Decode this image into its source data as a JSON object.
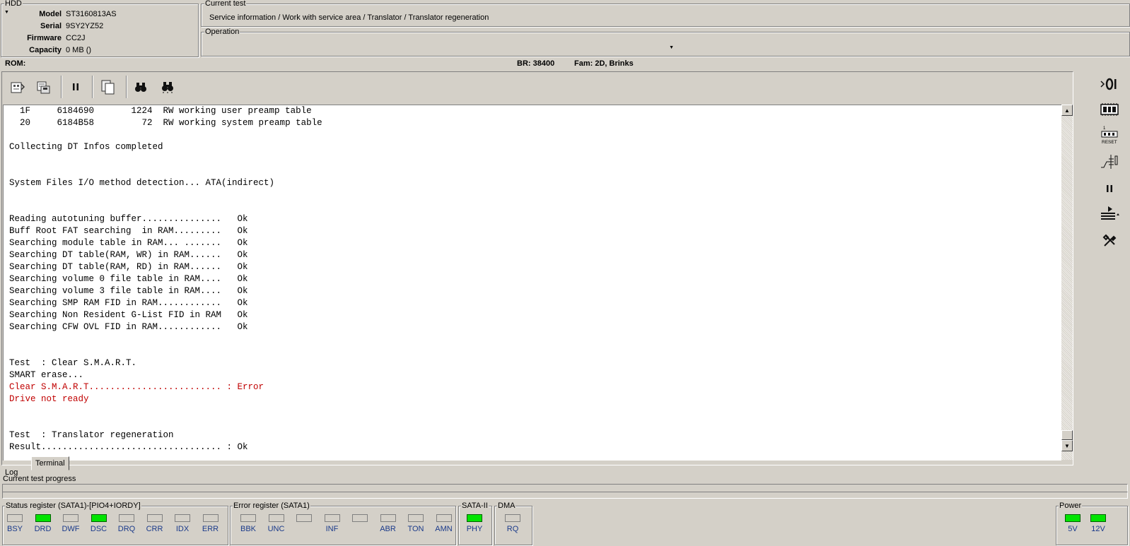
{
  "hdd": {
    "legend": "HDD",
    "rows": [
      {
        "key": "Model",
        "value": "ST3160813AS"
      },
      {
        "key": "Serial",
        "value": "9SY2YZ52"
      },
      {
        "key": "Firmware",
        "value": "CC2J"
      },
      {
        "key": "Capacity",
        "value": "0 MB ()"
      }
    ]
  },
  "current_test": {
    "legend": "Current test",
    "path": "Service information / Work with service area / Translator / Translator regeneration"
  },
  "operation": {
    "legend": "Operation",
    "value": ""
  },
  "info_bar": {
    "rom_label": "ROM:",
    "br": "BR: 38400",
    "fam": "Fam: 2D, Brinks"
  },
  "toolbar": {
    "icons": [
      "rom-read-icon",
      "rom-write-icon",
      "pause-icon",
      "copy-icon",
      "find-icon",
      "find-next-icon"
    ]
  },
  "log": {
    "lines": [
      {
        "text": "  1F     6184690       1224  RW working user preamp table",
        "error": false
      },
      {
        "text": "  20     6184B58         72  RW working system preamp table",
        "error": false
      },
      {
        "text": "",
        "error": false
      },
      {
        "text": "Collecting DT Infos completed",
        "error": false
      },
      {
        "text": "",
        "error": false
      },
      {
        "text": "",
        "error": false
      },
      {
        "text": "System Files I/O method detection... ATA(indirect)",
        "error": false
      },
      {
        "text": "",
        "error": false
      },
      {
        "text": "",
        "error": false
      },
      {
        "text": "Reading autotuning buffer...............   Ok",
        "error": false
      },
      {
        "text": "Buff Root FAT searching  in RAM.........   Ok",
        "error": false
      },
      {
        "text": "Searching module table in RAM... .......   Ok",
        "error": false
      },
      {
        "text": "Searching DT table(RAM, WR) in RAM......   Ok",
        "error": false
      },
      {
        "text": "Searching DT table(RAM, RD) in RAM......   Ok",
        "error": false
      },
      {
        "text": "Searching volume 0 file table in RAM....   Ok",
        "error": false
      },
      {
        "text": "Searching volume 3 file table in RAM....   Ok",
        "error": false
      },
      {
        "text": "Searching SMP RAM FID in RAM............   Ok",
        "error": false
      },
      {
        "text": "Searching Non Resident G-List FID in RAM   Ok",
        "error": false
      },
      {
        "text": "Searching CFW OVL FID in RAM............   Ok",
        "error": false
      },
      {
        "text": "",
        "error": false
      },
      {
        "text": "",
        "error": false
      },
      {
        "text": "Test  : Clear S.M.A.R.T.",
        "error": false
      },
      {
        "text": "SMART erase...",
        "error": false
      },
      {
        "text": "Clear S.M.A.R.T......................... : Error",
        "error": true
      },
      {
        "text": "Drive not ready",
        "error": true
      },
      {
        "text": "",
        "error": false
      },
      {
        "text": "",
        "error": false
      },
      {
        "text": "Test  : Translator regeneration",
        "error": false
      },
      {
        "text": "Result.................................. : Ok",
        "error": false
      }
    ]
  },
  "tabs": [
    {
      "label": "Log",
      "active": false
    },
    {
      "label": "Terminal",
      "active": true
    }
  ],
  "progress": {
    "label": "Current test progress",
    "value": 0
  },
  "status_register": {
    "legend": "Status register (SATA1)-[PIO4+IORDY]",
    "leds": [
      {
        "label": "BSY",
        "on": false
      },
      {
        "label": "DRD",
        "on": true
      },
      {
        "label": "DWF",
        "on": false
      },
      {
        "label": "DSC",
        "on": true
      },
      {
        "label": "DRQ",
        "on": false
      },
      {
        "label": "CRR",
        "on": false
      },
      {
        "label": "IDX",
        "on": false
      },
      {
        "label": "ERR",
        "on": false
      }
    ]
  },
  "error_register": {
    "legend": "Error register (SATA1)",
    "leds": [
      {
        "label": "BBK",
        "on": false
      },
      {
        "label": "UNC",
        "on": false
      },
      {
        "label": "",
        "on": false
      },
      {
        "label": "INF",
        "on": false
      },
      {
        "label": "",
        "on": false
      },
      {
        "label": "ABR",
        "on": false
      },
      {
        "label": "TON",
        "on": false
      },
      {
        "label": "AMN",
        "on": false
      }
    ]
  },
  "sata": {
    "legend": "SATA-II",
    "leds": [
      {
        "label": "PHY",
        "on": true
      }
    ]
  },
  "dma": {
    "legend": "DMA",
    "leds": [
      {
        "label": "RQ",
        "on": false
      }
    ]
  },
  "power": {
    "legend": "Power",
    "leds": [
      {
        "label": "5V",
        "on": true
      },
      {
        "label": "12V",
        "on": true
      }
    ]
  },
  "right_toolbar": {
    "icons": [
      "power-toggle-icon",
      "board-icon",
      "reset-icon",
      "relay-icon",
      "pause-icon",
      "transfer-icon",
      "tools-icon"
    ]
  },
  "colors": {
    "background": "#d4d0c8",
    "led_on": "#00e400",
    "error_text": "#c00000",
    "led_label": "#1a3a8a"
  }
}
